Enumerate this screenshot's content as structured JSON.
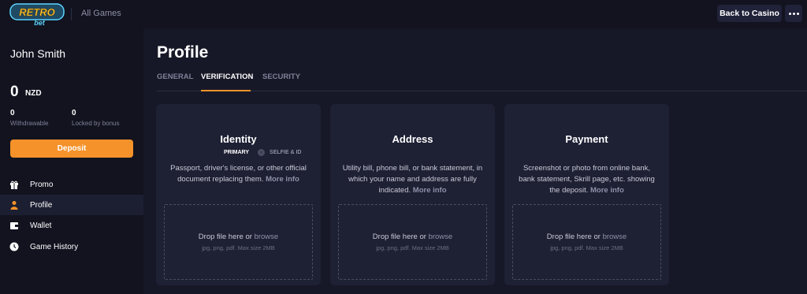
{
  "brand": {
    "logo_top": "RETRO",
    "logo_bottom": "bet",
    "accent": "#f5922a"
  },
  "topbar": {
    "all_games": "All Games",
    "back_label": "Back to Casino",
    "more_icon": "more-horizontal-icon"
  },
  "user": {
    "name": "John Smith",
    "balance": "0",
    "currency": "NZD",
    "withdrawable_value": "0",
    "withdrawable_label": "Withdrawable",
    "locked_value": "0",
    "locked_label": "Locked by bonus",
    "deposit_label": "Deposit"
  },
  "nav": [
    {
      "label": "Promo",
      "icon": "gift-icon"
    },
    {
      "label": "Profile",
      "icon": "user-icon"
    },
    {
      "label": "Wallet",
      "icon": "wallet-icon"
    },
    {
      "label": "Game History",
      "icon": "clock-icon"
    }
  ],
  "page": {
    "title": "Profile",
    "tabs": [
      "GENERAL",
      "VERIFICATION",
      "SECURITY"
    ],
    "active_tab": "VERIFICATION"
  },
  "cards": [
    {
      "title": "Identity",
      "step_primary": "PRIMARY",
      "step_secondary": "SELFIE & ID",
      "desc": "Passport, driver's license, or other official document replacing them.",
      "more_info": "More info",
      "drop_text": "Drop file here or",
      "browse": "browse",
      "hint": "jpg, png, pdf. Max size 2MB"
    },
    {
      "title": "Address",
      "desc": "Utility bill, phone bill, or bank statement, in which your name and address are fully indicated.",
      "more_info": "More info",
      "drop_text": "Drop file here or",
      "browse": "browse",
      "hint": "jpg, png, pdf. Max size 2MB"
    },
    {
      "title": "Payment",
      "desc": "Screenshot or photo from online bank, bank statement, Skrill page, etc. showing the deposit.",
      "more_info": "More info",
      "drop_text": "Drop file here or",
      "browse": "browse",
      "hint": "jpg, png, pdf. Max size 2MB"
    }
  ]
}
